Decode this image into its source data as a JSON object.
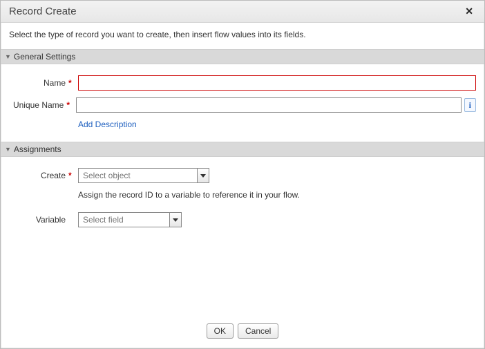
{
  "dialog": {
    "title": "Record Create",
    "close_label": "✕",
    "description": "Select the type of record you want to create, then insert flow values into its fields."
  },
  "sections": {
    "general": {
      "header": "General Settings",
      "name_label": "Name",
      "name_value": "",
      "unique_label": "Unique Name",
      "unique_value": "",
      "add_description_link": "Add Description",
      "info_icon": "i"
    },
    "assignments": {
      "header": "Assignments",
      "create_label": "Create",
      "create_placeholder": "Select object",
      "helper": "Assign the record ID to a variable to reference it in your flow.",
      "variable_label": "Variable",
      "variable_placeholder": "Select field"
    }
  },
  "buttons": {
    "ok": "OK",
    "cancel": "Cancel"
  },
  "required_marker": "*"
}
